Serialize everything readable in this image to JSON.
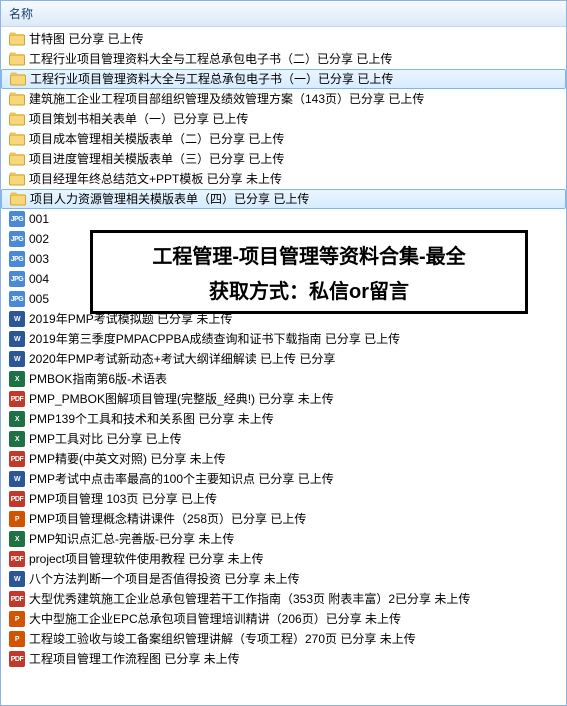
{
  "header": {
    "column": "名称"
  },
  "overlay": {
    "line1": "工程管理-项目管理等资料合集-最全",
    "line2": "获取方式：私信or留言"
  },
  "items": [
    {
      "icon": "folder",
      "label": "甘特图 已分享 已上传",
      "selected": false
    },
    {
      "icon": "folder",
      "label": "工程行业项目管理资料大全与工程总承包电子书（二）已分享 已上传",
      "selected": false
    },
    {
      "icon": "folder",
      "label": "工程行业项目管理资料大全与工程总承包电子书（一）已分享 已上传",
      "selected": true
    },
    {
      "icon": "folder",
      "label": "建筑施工企业工程项目部组织管理及绩效管理方案（143页）已分享 已上传",
      "selected": false
    },
    {
      "icon": "folder",
      "label": "项目策划书相关表单（一）已分享 已上传",
      "selected": false
    },
    {
      "icon": "folder",
      "label": "项目成本管理相关模版表单（二）已分享 已上传",
      "selected": false
    },
    {
      "icon": "folder",
      "label": "项目进度管理相关模版表单（三）已分享 已上传",
      "selected": false
    },
    {
      "icon": "folder",
      "label": "项目经理年终总结范文+PPT模板 已分享 未上传",
      "selected": false
    },
    {
      "icon": "folder",
      "label": "项目人力资源管理相关模版表单（四）已分享 已上传",
      "selected": true
    },
    {
      "icon": "jpg",
      "label": "001",
      "selected": false
    },
    {
      "icon": "jpg",
      "label": "002",
      "selected": false
    },
    {
      "icon": "jpg",
      "label": "003",
      "selected": false
    },
    {
      "icon": "jpg",
      "label": "004",
      "selected": false
    },
    {
      "icon": "jpg",
      "label": "005",
      "selected": false
    },
    {
      "icon": "doc",
      "label": "2019年PMP考试模拟题 已分享 未上传",
      "selected": false
    },
    {
      "icon": "doc",
      "label": "2019年第三季度PMPACPPBA成绩查询和证书下载指南 已分享 已上传",
      "selected": false
    },
    {
      "icon": "doc",
      "label": "2020年PMP考试新动态+考试大纲详细解读 已上传 已分享",
      "selected": false
    },
    {
      "icon": "xls",
      "label": "PMBOK指南第6版-术语表",
      "selected": false
    },
    {
      "icon": "pdf",
      "label": "PMP_PMBOK图解项目管理(完整版_经典!) 已分享 未上传",
      "selected": false
    },
    {
      "icon": "xls",
      "label": "PMP139个工具和技术和关系图 已分享 未上传",
      "selected": false
    },
    {
      "icon": "xls",
      "label": "PMP工具对比 已分享 已上传",
      "selected": false
    },
    {
      "icon": "pdf",
      "label": "PMP精要(中英文对照) 已分享 未上传",
      "selected": false
    },
    {
      "icon": "doc",
      "label": "PMP考试中点击率最高的100个主要知识点 已分享 已上传",
      "selected": false
    },
    {
      "icon": "pdf",
      "label": "PMP项目管理 103页 已分享 已上传",
      "selected": false
    },
    {
      "icon": "ppt",
      "label": "PMP项目管理概念精讲课件（258页）已分享 已上传",
      "selected": false
    },
    {
      "icon": "xls",
      "label": "PMP知识点汇总-完善版-已分享 未上传",
      "selected": false
    },
    {
      "icon": "pdf",
      "label": "project项目管理软件使用教程 已分享 未上传",
      "selected": false
    },
    {
      "icon": "doc",
      "label": "八个方法判断一个项目是否值得投资 已分享 未上传",
      "selected": false
    },
    {
      "icon": "pdf",
      "label": "大型优秀建筑施工企业总承包管理若干工作指南（353页 附表丰富）2已分享 未上传",
      "selected": false
    },
    {
      "icon": "ppt",
      "label": "大中型施工企业EPC总承包项目管理培训精讲（206页）已分享 未上传",
      "selected": false
    },
    {
      "icon": "ppt",
      "label": "工程竣工验收与竣工备案组织管理讲解（专项工程）270页 已分享 未上传",
      "selected": false
    },
    {
      "icon": "pdf",
      "label": "工程项目管理工作流程图 已分享 未上传",
      "selected": false
    }
  ]
}
